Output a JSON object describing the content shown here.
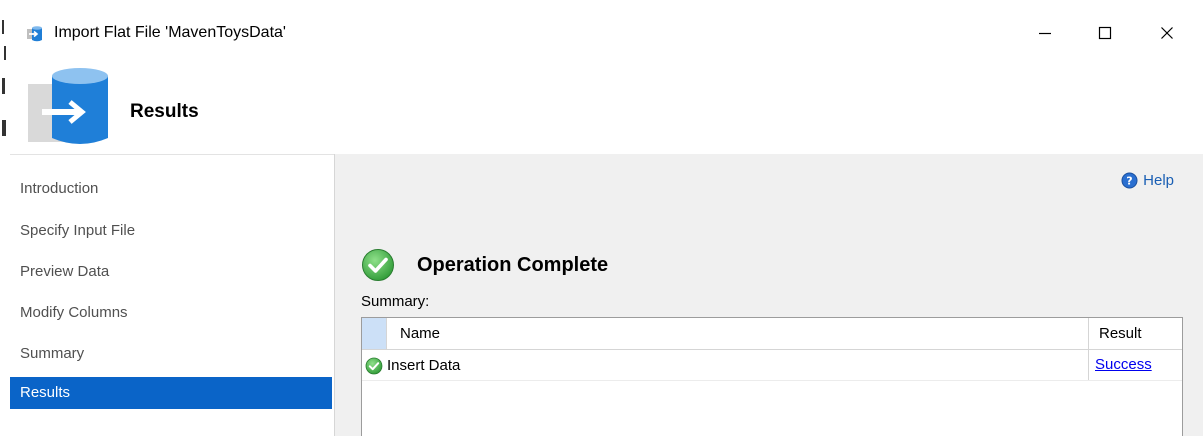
{
  "window": {
    "title": "Import Flat File 'MavenToysData'"
  },
  "header": {
    "title": "Results"
  },
  "sidebar": {
    "items": [
      {
        "label": "Introduction",
        "active": false
      },
      {
        "label": "Specify Input File",
        "active": false
      },
      {
        "label": "Preview Data",
        "active": false
      },
      {
        "label": "Modify Columns",
        "active": false
      },
      {
        "label": "Summary",
        "active": false
      },
      {
        "label": "Results",
        "active": true
      }
    ]
  },
  "content": {
    "help_label": "Help",
    "operation_title": "Operation Complete",
    "summary_label": "Summary:",
    "table": {
      "columns": [
        "Name",
        "Result"
      ],
      "rows": [
        {
          "name": "Insert Data",
          "result": "Success"
        }
      ]
    }
  },
  "colors": {
    "active_nav_bg": "#0a64c8",
    "success_green": "#3cb043",
    "link_blue": "#0000ee",
    "content_bg": "#f0f0f0"
  },
  "icons": {
    "app": "database-import-icon",
    "header": "database-arrow-icon",
    "help": "help-icon",
    "operation": "success-check-icon",
    "row": "success-check-icon"
  }
}
